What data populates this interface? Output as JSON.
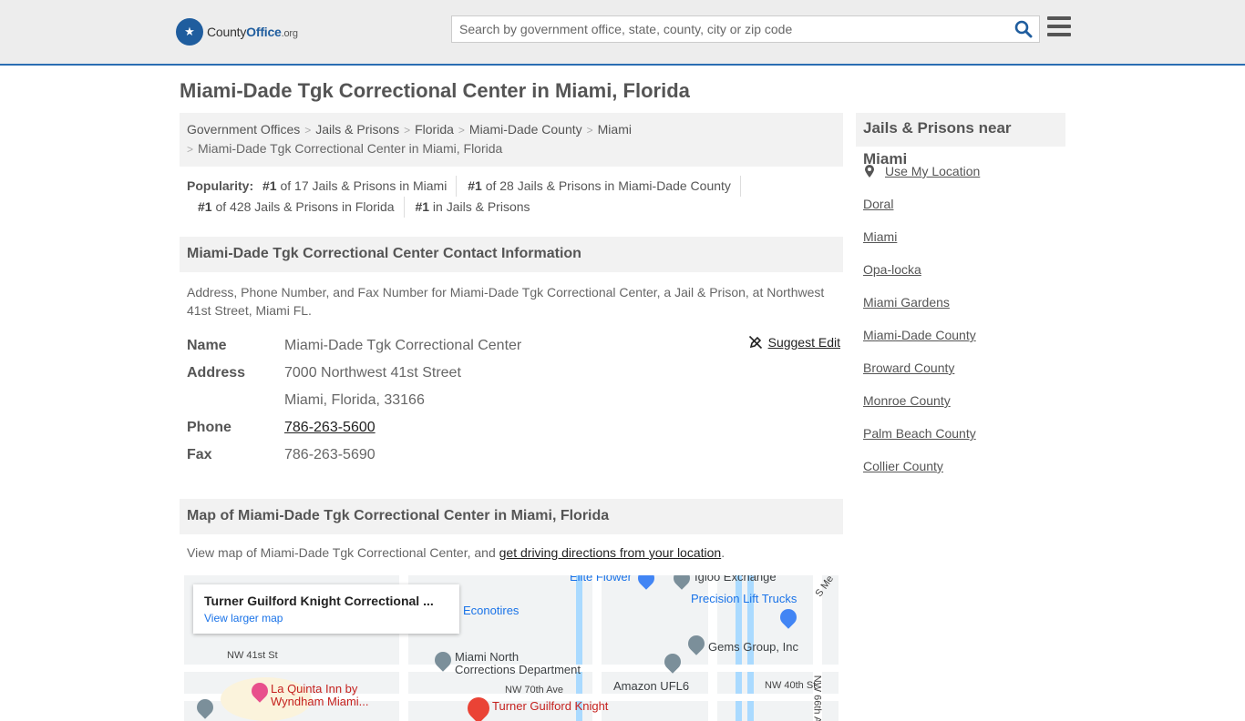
{
  "header": {
    "logo_text_1": "County",
    "logo_text_2": "Office",
    "logo_text_3": ".org",
    "search_placeholder": "Search by government office, state, county, city or zip code",
    "accent_color": "#1f5d9e"
  },
  "page_title": "Miami-Dade Tgk Correctional Center in Miami, Florida",
  "breadcrumb": {
    "items": [
      "Government Offices",
      "Jails & Prisons",
      "Florida",
      "Miami-Dade County",
      "Miami"
    ],
    "current": "Miami-Dade Tgk Correctional Center in Miami, Florida",
    "separator": ">"
  },
  "popularity": {
    "label": "Popularity:",
    "items": [
      {
        "rank": "#1",
        "text": "of 17 Jails & Prisons in Miami"
      },
      {
        "rank": "#1",
        "text": "of 28 Jails & Prisons in Miami-Dade County"
      },
      {
        "rank": "#1",
        "text": "of 428 Jails & Prisons in Florida"
      },
      {
        "rank": "#1",
        "text": "in Jails & Prisons"
      }
    ]
  },
  "contact": {
    "heading": "Miami-Dade Tgk Correctional Center Contact Information",
    "description": "Address, Phone Number, and Fax Number for Miami-Dade Tgk Correctional Center, a Jail & Prison, at Northwest 41st Street, Miami FL.",
    "suggest_edit": "Suggest Edit",
    "name_label": "Name",
    "name": "Miami-Dade Tgk Correctional Center",
    "address_label": "Address",
    "address_line1": "7000 Northwest 41st Street",
    "address_line2": "Miami, Florida, 33166",
    "phone_label": "Phone",
    "phone": "786-263-5600",
    "fax_label": "Fax",
    "fax": "786-263-5690"
  },
  "map_section": {
    "heading": "Map of Miami-Dade Tgk Correctional Center in Miami, Florida",
    "description_prefix": "View map of Miami-Dade Tgk Correctional Center, and ",
    "directions_link": "get driving directions from your location",
    "description_suffix": ".",
    "card_title": "Turner Guilford Knight Correctional ...",
    "card_link": "View larger map",
    "labels": {
      "elite_flower": "Elite Flower",
      "igloo": "Igloo Exchange",
      "precision": "Precision Lift Trucks",
      "econotires": "Econotires",
      "gems": "Gems Group, Inc",
      "mdnorth_1": "Miami North",
      "mdnorth_2": "Corrections Department",
      "nw41": "NW 41st St",
      "nw70": "NW 70th Ave",
      "nw40": "NW 40th St",
      "amazon": "Amazon UFL6",
      "laquinta_1": "La Quinta Inn by",
      "laquinta_2": "Wyndham Miami...",
      "turner": "Turner Guilford Knight",
      "nw66": "NW 66th A",
      "sme": "S Me"
    }
  },
  "sidebar": {
    "heading": "Jails & Prisons near Miami",
    "use_location": "Use My Location",
    "links": [
      "Doral",
      "Miami",
      "Opa-locka",
      "Miami Gardens",
      "Miami-Dade County",
      "Broward County",
      "Monroe County",
      "Palm Beach County",
      "Collier County"
    ]
  }
}
